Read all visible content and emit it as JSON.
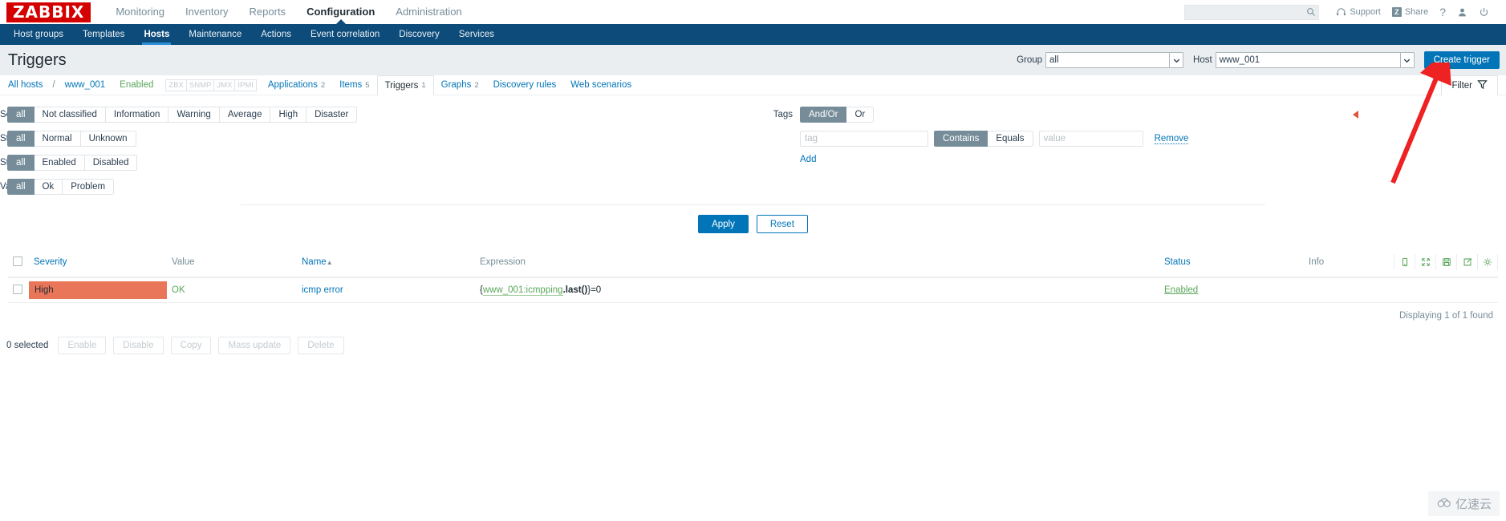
{
  "header": {
    "logo": "ZABBIX",
    "nav": [
      {
        "label": "Monitoring",
        "active": false
      },
      {
        "label": "Inventory",
        "active": false
      },
      {
        "label": "Reports",
        "active": false
      },
      {
        "label": "Configuration",
        "active": true
      },
      {
        "label": "Administration",
        "active": false
      }
    ],
    "search_placeholder": "",
    "search_value": "",
    "support_label": "Support",
    "share_label": "Share",
    "share_badge": "Z",
    "help_label": "?",
    "icons": [
      "search-icon",
      "headset-icon",
      "share-icon",
      "help-icon",
      "user-icon",
      "power-icon"
    ]
  },
  "subnav": [
    {
      "label": "Host groups",
      "active": false
    },
    {
      "label": "Templates",
      "active": false
    },
    {
      "label": "Hosts",
      "active": true
    },
    {
      "label": "Maintenance",
      "active": false
    },
    {
      "label": "Actions",
      "active": false
    },
    {
      "label": "Event correlation",
      "active": false
    },
    {
      "label": "Discovery",
      "active": false
    },
    {
      "label": "Services",
      "active": false
    }
  ],
  "page": {
    "title": "Triggers",
    "group_label": "Group",
    "group_value": "all",
    "host_label": "Host",
    "host_value": "www_001",
    "create_button": "Create trigger"
  },
  "breadcrumb": {
    "all_hosts": "All hosts",
    "separator": "/",
    "host": "www_001",
    "status": "Enabled",
    "protocols": [
      "ZBX",
      "SNMP",
      "JMX",
      "IPMI"
    ],
    "tabs": [
      {
        "label": "Applications",
        "count": "2",
        "selected": false
      },
      {
        "label": "Items",
        "count": "5",
        "selected": false
      },
      {
        "label": "Triggers",
        "count": "1",
        "selected": true
      },
      {
        "label": "Graphs",
        "count": "2",
        "selected": false
      },
      {
        "label": "Discovery rules",
        "count": "",
        "selected": false
      },
      {
        "label": "Web scenarios",
        "count": "",
        "selected": false
      }
    ],
    "filter_tab": "Filter"
  },
  "filter": {
    "severity": {
      "label": "Severity",
      "options": [
        "all",
        "Not classified",
        "Information",
        "Warning",
        "Average",
        "High",
        "Disaster"
      ],
      "selected": "all"
    },
    "state": {
      "label": "State",
      "options": [
        "all",
        "Normal",
        "Unknown"
      ],
      "selected": "all"
    },
    "status": {
      "label": "Status",
      "options": [
        "all",
        "Enabled",
        "Disabled"
      ],
      "selected": "all"
    },
    "value": {
      "label": "Value",
      "options": [
        "all",
        "Ok",
        "Problem"
      ],
      "selected": "all"
    },
    "tags": {
      "label": "Tags",
      "operator_options": [
        "And/Or",
        "Or"
      ],
      "operator_selected": "And/Or",
      "tag_placeholder": "tag",
      "tag_value": "",
      "match_options": [
        "Contains",
        "Equals"
      ],
      "match_selected": "Contains",
      "value_placeholder": "value",
      "value_value": "",
      "remove_label": "Remove",
      "add_label": "Add"
    },
    "apply_label": "Apply",
    "reset_label": "Reset"
  },
  "table": {
    "columns": [
      {
        "key": "checkbox",
        "label": ""
      },
      {
        "key": "severity",
        "label": "Severity",
        "sortable": true
      },
      {
        "key": "value",
        "label": "Value",
        "sortable": false
      },
      {
        "key": "name",
        "label": "Name",
        "sortable": true,
        "sort_dir": "▲"
      },
      {
        "key": "expression",
        "label": "Expression",
        "sortable": false
      },
      {
        "key": "status",
        "label": "Status",
        "sortable": true
      },
      {
        "key": "info",
        "label": "Info",
        "sortable": false
      }
    ],
    "header_icons": [
      "mobile-icon",
      "expand-icon",
      "save-icon",
      "export-icon",
      "gear-icon"
    ],
    "rows": [
      {
        "severity": "High",
        "severity_color": "#e97659",
        "value": "OK",
        "name": "icmp error",
        "expression_link": "{www_001:icmpping",
        "expression_rest": ".last()}=0",
        "status": "Enabled",
        "info": ""
      }
    ],
    "found_text": "Displaying 1 of 1 found"
  },
  "footer": {
    "selected_text": "0 selected",
    "actions": [
      "Enable",
      "Disable",
      "Copy",
      "Mass update",
      "Delete"
    ]
  },
  "watermark": {
    "text": "亿速云"
  },
  "colors": {
    "brand_red": "#d40000",
    "nav_blue": "#0c4b7a",
    "accent_blue": "#0275b8",
    "green": "#59a659",
    "high_severity": "#e97659",
    "grey_selected": "#768d99",
    "annotation_red": "#ee2222"
  }
}
